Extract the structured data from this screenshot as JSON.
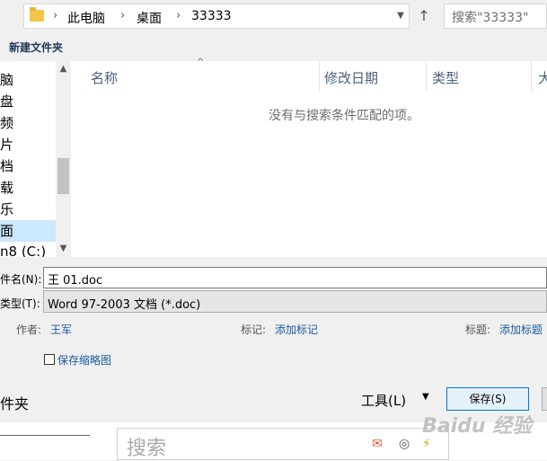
{
  "address": {
    "crumbs": [
      "此电脑",
      "桌面",
      "33333"
    ],
    "separator": "›",
    "dropdown_icon": "chevron-down-icon",
    "refresh_icon": "refresh-icon"
  },
  "search": {
    "placeholder": "搜索\"33333\""
  },
  "toolbar": {
    "new_folder": "新建文件夹"
  },
  "nav": {
    "items": [
      "脑",
      "盘",
      "频",
      "片",
      "档",
      "载",
      "乐",
      "面",
      "n8 (C:)"
    ],
    "selected_index": 7
  },
  "file_list": {
    "columns": [
      "名称",
      "修改日期",
      "类型",
      "大"
    ],
    "empty_message": "没有与搜索条件匹配的项。"
  },
  "form": {
    "filename_label": "件名(N):",
    "filename_value": "王 01.doc",
    "filetype_label": "类型(T):",
    "filetype_value": "Word 97-2003 文档 (*.doc)",
    "author_label": "作者:",
    "author_value": "王军",
    "tags_label": "标记:",
    "tags_value": "添加标记",
    "title_label": "标题:",
    "title_value": "添加标题",
    "thumbnail_label": "保存缩略图"
  },
  "footer": {
    "hide_folders": "件夹",
    "tools_label": "工具(L)",
    "save_label": "保存(S)"
  },
  "background": {
    "search_text": "搜索",
    "watermark": "Baidu 经验"
  },
  "colors": {
    "accent": "#0078d7",
    "link": "#1a5aa0",
    "selected": "#cce8ff"
  }
}
